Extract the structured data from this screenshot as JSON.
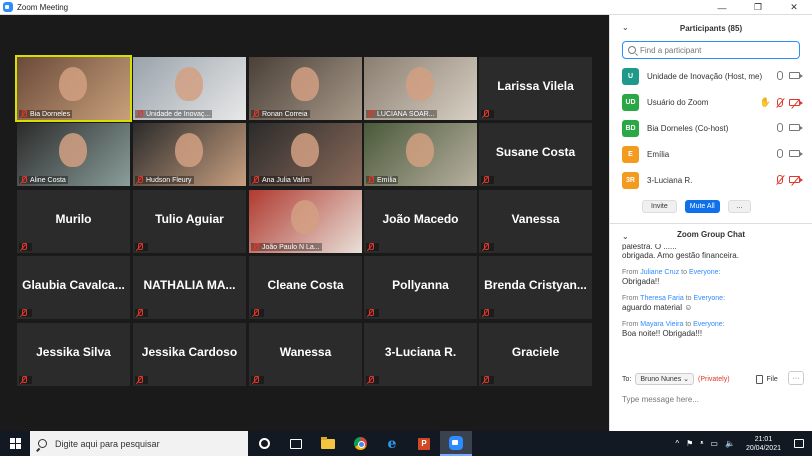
{
  "window": {
    "title": "Zoom Meeting",
    "controls": [
      "—",
      "❐",
      "✕"
    ]
  },
  "tiles": [
    {
      "row": 0,
      "col": 0,
      "label": "Bia Dorneles",
      "video": true,
      "active": true,
      "bg": [
        "#6a4a3a",
        "#c8a07a"
      ]
    },
    {
      "row": 0,
      "col": 1,
      "label": "Unidade de Inovaç...",
      "video": true,
      "bg": [
        "#9aa3ab",
        "#e8e8e8"
      ]
    },
    {
      "row": 0,
      "col": 2,
      "label": "Ronan Correia",
      "video": true,
      "bg": [
        "#4a4038",
        "#a89a8a"
      ]
    },
    {
      "row": 0,
      "col": 3,
      "label": "LUCIANA SOAR...",
      "video": true,
      "bg": [
        "#8a7e70",
        "#d8d0c4"
      ]
    },
    {
      "row": 0,
      "col": 4,
      "label": "",
      "name": "Larissa Vilela"
    },
    {
      "row": 1,
      "col": 0,
      "label": "Aline Costa",
      "video": true,
      "bg": [
        "#2b2b2b",
        "#8a9e9a"
      ]
    },
    {
      "row": 1,
      "col": 1,
      "label": "Hudson Fleury",
      "video": true,
      "bg": [
        "#2b2b2b",
        "#c9a080"
      ]
    },
    {
      "row": 1,
      "col": 2,
      "label": "Ana Julia Valim",
      "video": true,
      "bg": [
        "#2b2b2b",
        "#8a6a5a"
      ]
    },
    {
      "row": 1,
      "col": 3,
      "label": "Emília",
      "video": true,
      "bg": [
        "#4a5a3a",
        "#b8b0a0"
      ]
    },
    {
      "row": 1,
      "col": 4,
      "label": "",
      "name": "Susane Costa"
    },
    {
      "row": 2,
      "col": 0,
      "label": "",
      "name": "Murilo"
    },
    {
      "row": 2,
      "col": 1,
      "label": "",
      "name": "Tulio Aguiar"
    },
    {
      "row": 2,
      "col": 2,
      "label": "João Paulo N La...",
      "video": true,
      "bg": [
        "#b03a30",
        "#e8e0d8"
      ]
    },
    {
      "row": 2,
      "col": 3,
      "label": "",
      "name": "João Macedo"
    },
    {
      "row": 2,
      "col": 4,
      "label": "",
      "name": "Vanessa"
    },
    {
      "row": 3,
      "col": 0,
      "label": "",
      "name": "Glaubia Cavalca..."
    },
    {
      "row": 3,
      "col": 1,
      "label": "",
      "name": "NATHALIA MA..."
    },
    {
      "row": 3,
      "col": 2,
      "label": "",
      "name": "Cleane Costa"
    },
    {
      "row": 3,
      "col": 3,
      "label": "",
      "name": "Pollyanna"
    },
    {
      "row": 3,
      "col": 4,
      "label": "",
      "name": "Brenda Cristyan..."
    },
    {
      "row": 4,
      "col": 0,
      "label": "",
      "name": "Jessika Silva"
    },
    {
      "row": 4,
      "col": 1,
      "label": "",
      "name": "Jessika Cardoso"
    },
    {
      "row": 4,
      "col": 2,
      "label": "",
      "name": "Wanessa"
    },
    {
      "row": 4,
      "col": 3,
      "label": "",
      "name": "3-Luciana R."
    },
    {
      "row": 4,
      "col": 4,
      "label": "",
      "name": "Graciele"
    }
  ],
  "participants": {
    "title": "Participants (85)",
    "search_placeholder": "Find a participant",
    "list": [
      {
        "initials": "U",
        "name": "Unidade de Inovação (Host, me)",
        "color": "#1f9a8a",
        "hand": false,
        "mic_off": false,
        "cam_off": false
      },
      {
        "initials": "UD",
        "name": "Usuário do Zoom",
        "color": "#2aa845",
        "hand": true,
        "mic_off": true,
        "cam_off": true
      },
      {
        "initials": "BD",
        "name": "Bia Dorneles (Co-host)",
        "color": "#2aa845",
        "hand": false,
        "mic_off": false,
        "cam_off": false
      },
      {
        "initials": "E",
        "name": "Emília",
        "color": "#f29b1e",
        "hand": false,
        "mic_off": false,
        "cam_off": false
      },
      {
        "initials": "3R",
        "name": "3-Luciana R.",
        "color": "#f29b1e",
        "hand": false,
        "mic_off": true,
        "cam_off": true
      }
    ],
    "invite_label": "Invite",
    "mute_all_label": "Mute All",
    "more_label": "..."
  },
  "chat": {
    "title": "Zoom Group Chat",
    "cut_line": "palestra. O ......",
    "first_text": "obrigada. Amo gestão financeira.",
    "messages": [
      {
        "from_label": "From",
        "sender": "Juliane Cruz",
        "to_label": "to",
        "recipient": "Everyone",
        "text": "Obrigada!!"
      },
      {
        "from_label": "From",
        "sender": "Theresa Faria",
        "to_label": "to",
        "recipient": "Everyone",
        "text": "aguardo material ☺"
      },
      {
        "from_label": "From",
        "sender": "Mayara Vieira",
        "to_label": "to",
        "recipient": "Everyone",
        "text": "Boa noite!! Obrigada!!!"
      }
    ],
    "to_label": "To:",
    "to_value": "Bruno Nunes ⌄",
    "private_label": "(Privately)",
    "file_label": "File",
    "more_label": "···",
    "input_placeholder": "Type message here..."
  },
  "taskbar": {
    "search_text": "Digite aqui para pesquisar",
    "time": "21:01",
    "date": "20/04/2021",
    "tray": [
      "^",
      "⚑",
      "ᵜ",
      "▭",
      "🔈"
    ]
  },
  "colors": {
    "accent": "#2d8cff",
    "active_speaker": "#d6e000",
    "muted": "#e0362b",
    "tile_bg": "#2b2b2b"
  }
}
